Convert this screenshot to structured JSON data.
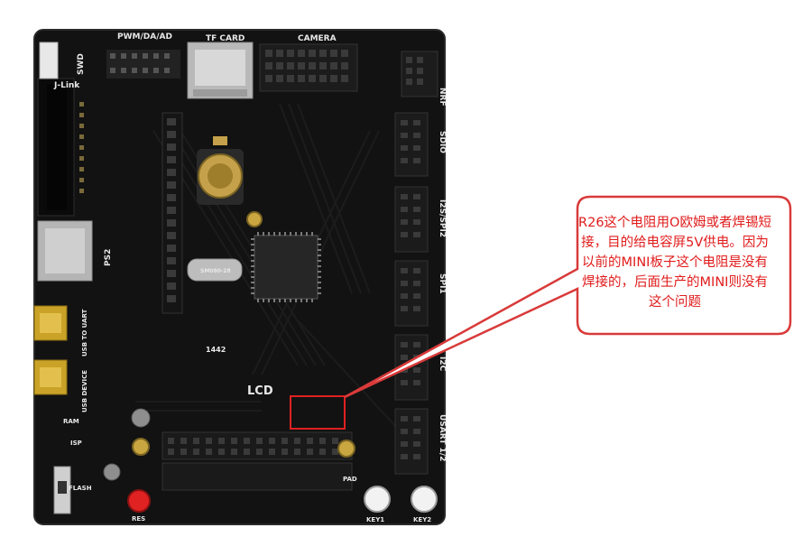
{
  "annotation": {
    "callout_text": "R26这个电阻用O欧姆或者焊锡短接，目的给电容屏5V供电。因为以前的MINI板子这个电阻是没有焊接的，后面生产的MINI则没有这个问题"
  },
  "board_labels": {
    "pwm": "PWM/DA/AD",
    "tfcard": "TF CARD",
    "camera": "CAMERA",
    "nrf": "NRF",
    "sdio": "SDIO",
    "i2s_spi2": "I2S/SPI2",
    "spi1": "SPI1",
    "i2c": "I2C",
    "usart": "USART 1/2",
    "lcd": "LCD",
    "ps2": "PS2",
    "usb_uart": "USB TO UART",
    "usb_device": "USB DEVICE",
    "swd": "SWD",
    "jlink": "J-Link",
    "ram": "RAM",
    "isp": "ISP",
    "flash": "FLASH",
    "key1": "KEY1",
    "key2": "KEY2",
    "res": "RES",
    "pad": "PAD",
    "chip_code": "1442",
    "crystal": "SM080-28"
  }
}
